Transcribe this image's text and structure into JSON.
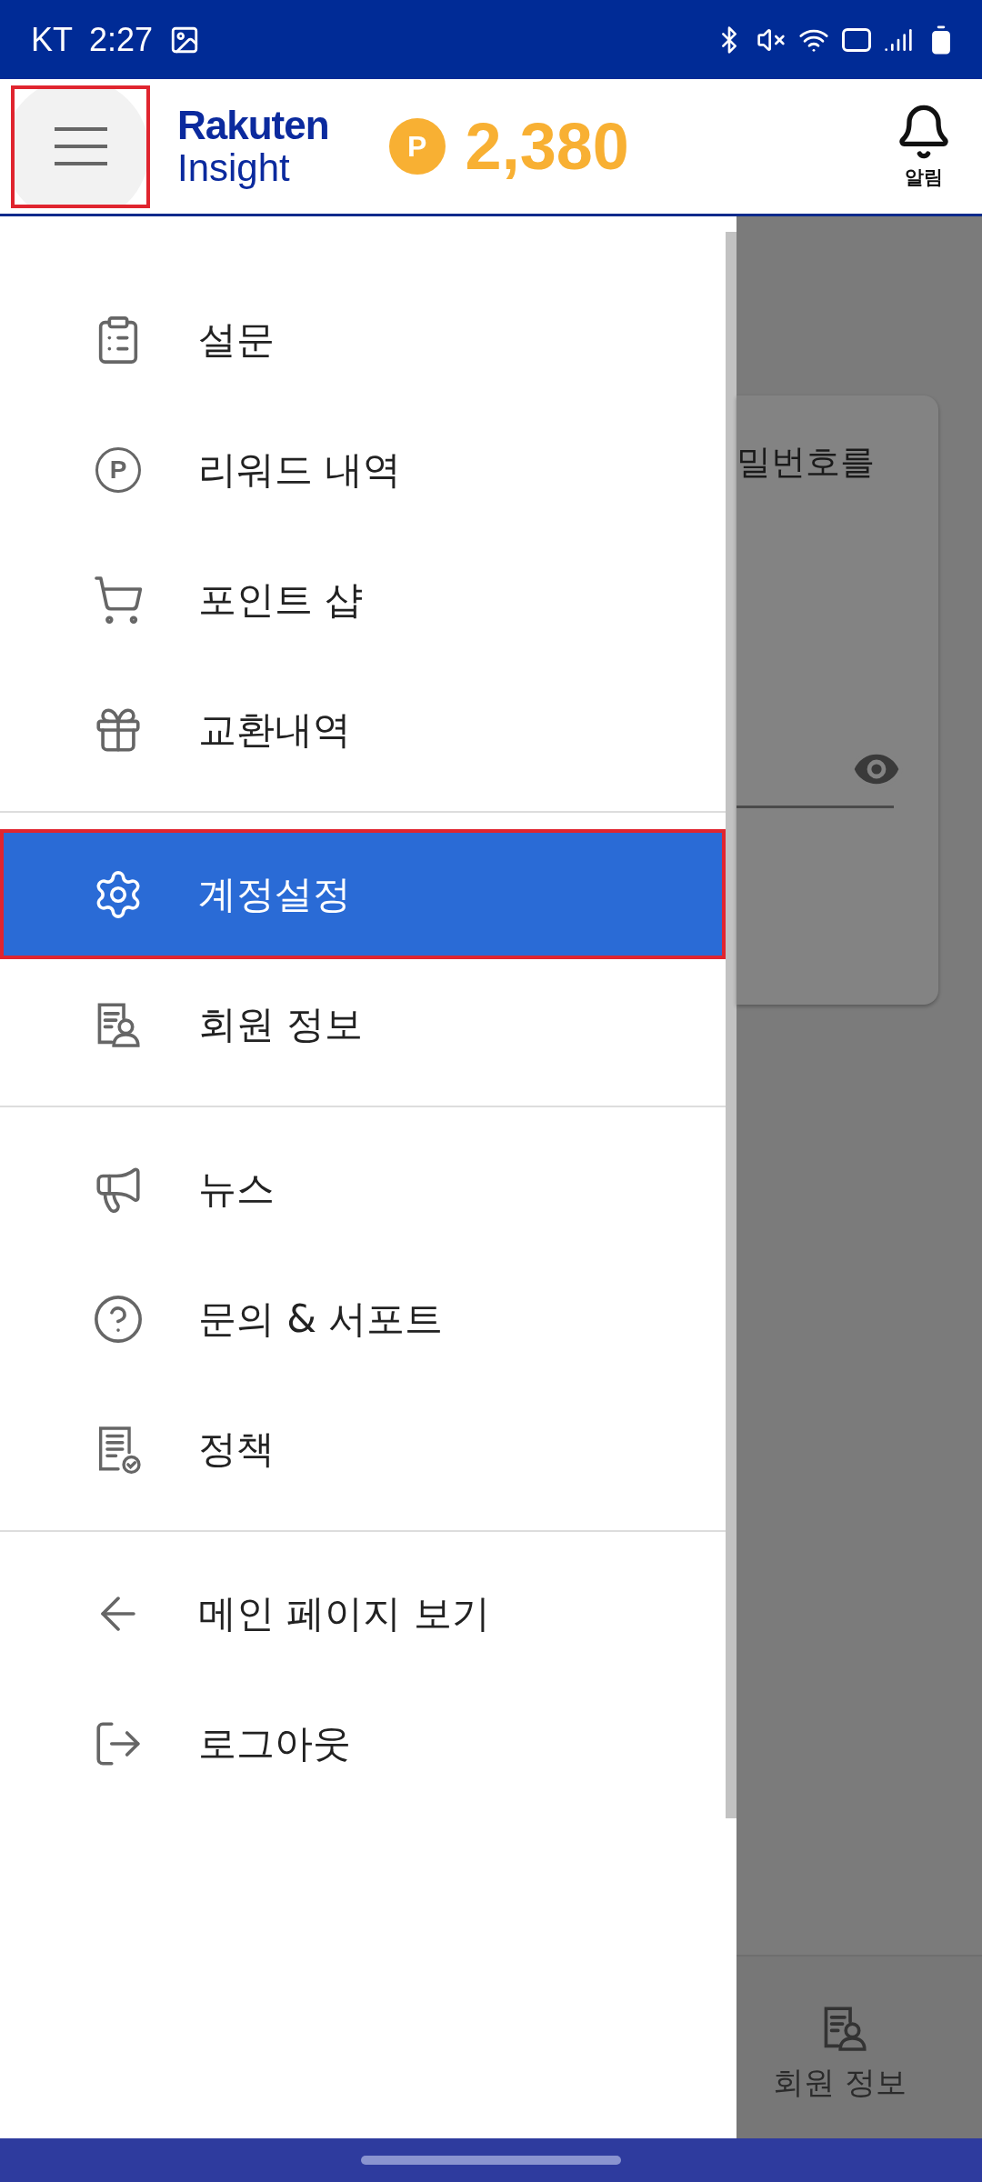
{
  "status_bar": {
    "carrier": "KT",
    "time": "2:27"
  },
  "header": {
    "menu_button": {
      "highlighted": true
    },
    "logo": {
      "line_1": "Rakuten",
      "line_2": "Insight"
    },
    "points_badge": "P",
    "points": "2,380",
    "notifications_label": "알림"
  },
  "drawer": {
    "sections": [
      {
        "items": [
          {
            "label": "설문",
            "kind": "clipboard",
            "selected": false,
            "highlighted": false
          },
          {
            "label": "리워드 내역",
            "kind": "points",
            "icon_letter": "P",
            "selected": false,
            "highlighted": false
          },
          {
            "label": "포인트 샵",
            "kind": "cart",
            "selected": false,
            "highlighted": false
          },
          {
            "label": "교환내역",
            "kind": "gift",
            "selected": false,
            "highlighted": false
          }
        ]
      },
      {
        "items": [
          {
            "label": "계정설정",
            "kind": "gear",
            "selected": true,
            "highlighted": true
          },
          {
            "label": "회원 정보",
            "kind": "member",
            "selected": false,
            "highlighted": false
          }
        ]
      },
      {
        "items": [
          {
            "label": "뉴스",
            "kind": "megaphone",
            "selected": false,
            "highlighted": false
          },
          {
            "label": "문의 & 서포트",
            "kind": "help",
            "selected": false,
            "highlighted": false
          },
          {
            "label": "정책",
            "kind": "policy",
            "selected": false,
            "highlighted": false
          }
        ]
      },
      {
        "items": [
          {
            "label": "메인 페이지 보기",
            "kind": "back",
            "selected": false,
            "highlighted": false
          },
          {
            "label": "로그아웃",
            "kind": "logout",
            "selected": false,
            "highlighted": false
          }
        ]
      }
    ]
  },
  "background": {
    "card_text": "밀번호를",
    "bottom_nav_label": "회원 정보"
  }
}
